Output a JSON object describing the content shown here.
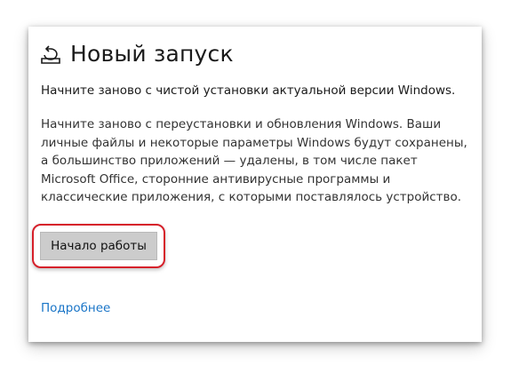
{
  "section": {
    "icon": "reset-icon",
    "title": "Новый запуск",
    "subtitle": "Начните заново с чистой установки актуальной версии Windows.",
    "description": "Начните заново с переустановки и обновления Windows. Ваши личные файлы и некоторые параметры Windows будут сохранены, а большинство приложений — удалены, в том числе пакет Microsoft Office, сторонние антивирусные программы и классические приложения, с которыми поставлялось устройство."
  },
  "actions": {
    "start_label": "Начало работы",
    "more_label": "Подробнее"
  },
  "colors": {
    "highlight": "#d6202a",
    "link": "#1a75c7",
    "button_bg": "#cccccc"
  }
}
